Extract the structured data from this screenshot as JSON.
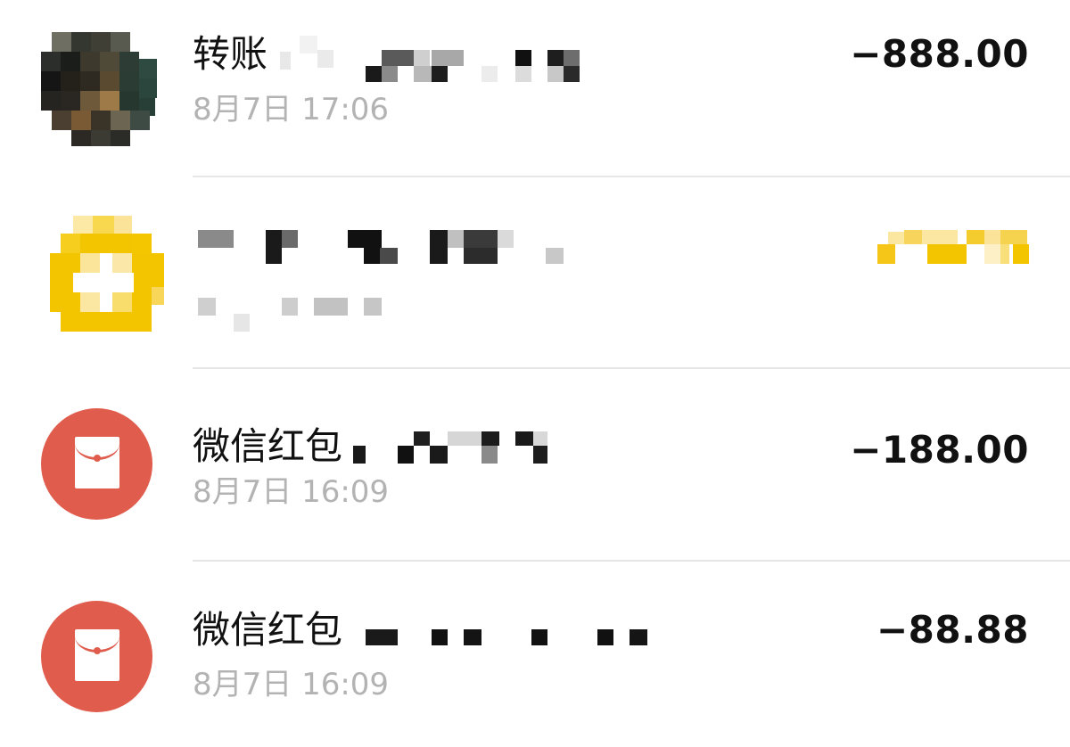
{
  "transactions": [
    {
      "icon": "user-avatar-icon",
      "title": "转账",
      "date": "8月7日 17:06",
      "amount": "−888.00"
    },
    {
      "icon": "yellow-merchant-icon",
      "title": "",
      "date": "",
      "amount": ""
    },
    {
      "icon": "red-packet-icon",
      "title": "微信红包",
      "date": "8月7日 16:09",
      "amount": "−188.00"
    },
    {
      "icon": "red-packet-icon",
      "title": "微信红包",
      "date": "8月7日 16:09",
      "amount": "−88.88"
    }
  ],
  "colors": {
    "red_packet": "#e05d4e",
    "merchant_yellow": "#f3c500",
    "date_gray": "#b3b3b3",
    "divider": "#e6e6e6"
  }
}
